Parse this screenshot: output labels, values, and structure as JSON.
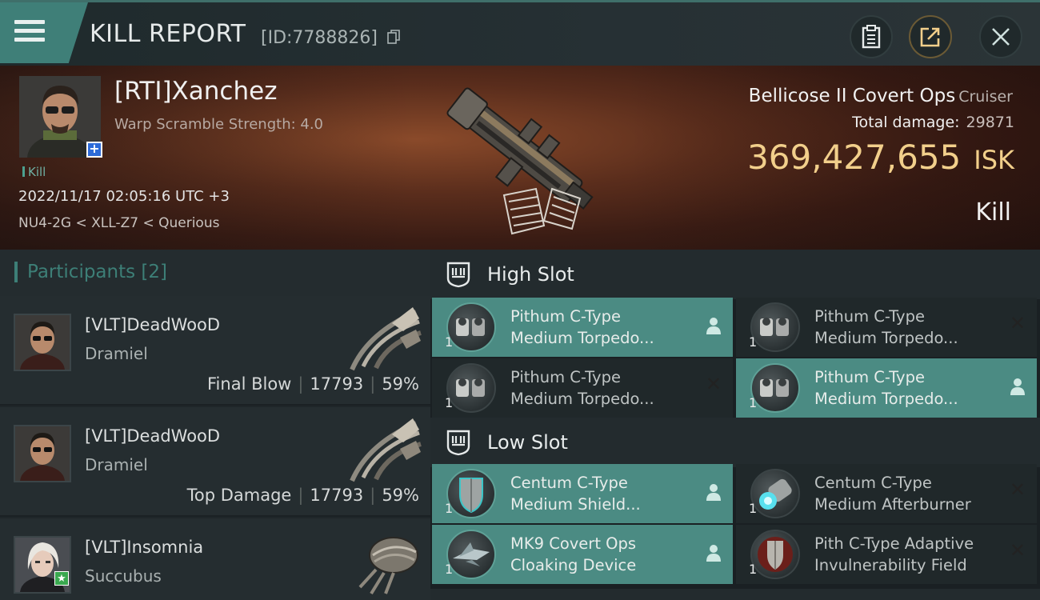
{
  "header": {
    "title": "KILL REPORT",
    "report_id": "[ID:7788826]"
  },
  "victim": {
    "name": "[RTI]Xanchez",
    "warp_scramble": "Warp Scramble Strength: 4.0",
    "tag": "Kill",
    "timestamp": "2022/11/17 02:05:16 UTC +3",
    "location": "NU4-2G < XLL-Z7 < Querious"
  },
  "ship": {
    "name": "Bellicose II Covert Ops",
    "class": "Cruiser",
    "total_damage_label": "Total damage:",
    "total_damage": "29871",
    "isk_value": "369,427,655",
    "isk_unit": "ISK",
    "result": "Kill"
  },
  "participants": {
    "title": "Participants [2]",
    "rows": [
      {
        "name": "[VLT]DeadWooD",
        "ship": "Dramiel",
        "role": "Final Blow",
        "damage": "17793",
        "percent": "59%"
      },
      {
        "name": "[VLT]DeadWooD",
        "ship": "Dramiel",
        "role": "Top Damage",
        "damage": "17793",
        "percent": "59%"
      },
      {
        "name": "[VLT]Insomnia",
        "ship": "Succubus"
      }
    ]
  },
  "slots": {
    "high_label": "High Slot",
    "low_label": "Low Slot",
    "high": [
      {
        "line1": "Pithum C-Type",
        "line2": "Medium Torpedo...",
        "qty": "1",
        "status": "dropped"
      },
      {
        "line1": "Pithum C-Type",
        "line2": "Medium Torpedo...",
        "qty": "1",
        "status": "destroyed"
      },
      {
        "line1": "Pithum C-Type",
        "line2": "Medium Torpedo...",
        "qty": "1",
        "status": "destroyed"
      },
      {
        "line1": "Pithum C-Type",
        "line2": "Medium Torpedo...",
        "qty": "1",
        "status": "dropped"
      }
    ],
    "low": [
      {
        "line1": "Centum C-Type",
        "line2": "Medium Shield...",
        "qty": "1",
        "status": "dropped"
      },
      {
        "line1": "Centum C-Type",
        "line2": "Medium Afterburner",
        "qty": "1",
        "status": "destroyed"
      },
      {
        "line1": "MK9 Covert Ops",
        "line2": "Cloaking Device",
        "qty": "1",
        "status": "dropped"
      },
      {
        "line1": "Pith C-Type Adaptive",
        "line2": "Invulnerability Field",
        "qty": "1",
        "status": "destroyed"
      }
    ]
  },
  "colors": {
    "accent": "#4b8b83",
    "isk": "#f2cf8b",
    "header_teal": "#3f7f78"
  }
}
